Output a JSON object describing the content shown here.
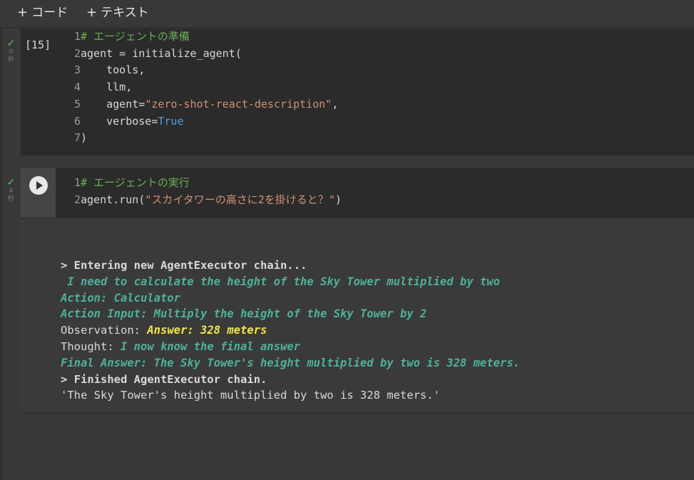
{
  "toolbar": {
    "add_code_label": "コード",
    "add_text_label": "テキスト",
    "plus": "+"
  },
  "cell1": {
    "exec_count": "[15]",
    "status_time": "0",
    "status_unit": "秒",
    "lines": [
      {
        "n": "1",
        "comment": "# エージェントの準備"
      },
      {
        "n": "2",
        "text": "agent = initialize_agent("
      },
      {
        "n": "3",
        "text": "    tools,"
      },
      {
        "n": "4",
        "text": "    llm,"
      },
      {
        "n": "5",
        "pre": "    agent=",
        "str": "\"zero-shot-react-description\"",
        "post": ","
      },
      {
        "n": "6",
        "pre": "    verbose=",
        "kw": "True"
      },
      {
        "n": "7",
        "text": ")"
      }
    ]
  },
  "cell2": {
    "status_time": "4",
    "status_unit": "秒",
    "lines": [
      {
        "n": "1",
        "comment": "# エージェントの実行"
      },
      {
        "n": "2",
        "pre": "agent.run(",
        "str": "\"スカイタワーの高さに2を掛けると？\"",
        "post": ")"
      }
    ]
  },
  "output": {
    "line1": "> Entering new AgentExecutor chain...",
    "line2": " I need to calculate the height of the Sky Tower multiplied by two",
    "line3": "Action: Calculator",
    "line4": "Action Input: Multiply the height of the Sky Tower by 2",
    "line5_label": "Observation: ",
    "line5_value": "Answer: 328 meters",
    "line6_label": "Thought: ",
    "line6_value": "I now know the final answer",
    "line7": "Final Answer: The Sky Tower's height multiplied by two is 328 meters.",
    "line8": "> Finished AgentExecutor chain.",
    "line9": "'The Sky Tower's height multiplied by two is 328 meters.'"
  },
  "colors": {
    "comment": "#6aaf55",
    "string": "#ce9178",
    "keyword": "#569cd6",
    "log_green": "#4fb09a",
    "log_yellow": "#f2e64a",
    "check": "#5bbf6b"
  }
}
